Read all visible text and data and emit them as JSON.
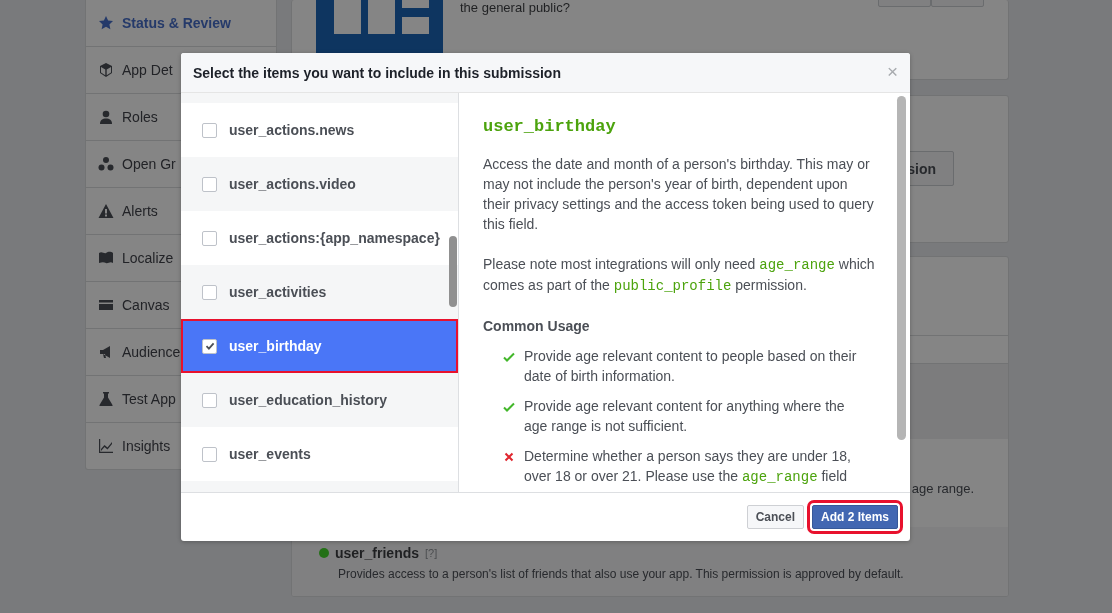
{
  "sidebar": {
    "items": [
      {
        "label": "Status & Review",
        "selected": true
      },
      {
        "label": "App Det",
        "selected": false
      },
      {
        "label": "Roles",
        "selected": false
      },
      {
        "label": "Open Gr",
        "selected": false
      },
      {
        "label": "Alerts",
        "selected": false
      },
      {
        "label": "Localize",
        "selected": false
      },
      {
        "label": "Canvas",
        "selected": false
      },
      {
        "label": "Audience",
        "selected": false
      },
      {
        "label": "Test App",
        "selected": false
      },
      {
        "label": "Insights",
        "selected": false
      }
    ]
  },
  "background": {
    "app_panel": {
      "question": "the general public?"
    },
    "submission_panel": {
      "button": "sion"
    },
    "permissions_panel": {
      "fragment": "age range.",
      "permissions": [
        {
          "name": "user_friends",
          "help": "[?]",
          "description": "Provides access to a person's list of friends that also use your app. This permission is approved by default.",
          "color": "#237016"
        }
      ]
    }
  },
  "dialog": {
    "title": "Select the items you want to include in this submission",
    "close": "×",
    "items": [
      {
        "label": "user_actions.news",
        "checked": false,
        "selected": false
      },
      {
        "label": "user_actions.video",
        "checked": false,
        "selected": false
      },
      {
        "label": "user_actions:{app_namespace}",
        "checked": false,
        "selected": false
      },
      {
        "label": "user_activities",
        "checked": false,
        "selected": false
      },
      {
        "label": "user_birthday",
        "checked": true,
        "selected": true
      },
      {
        "label": "user_education_history",
        "checked": false,
        "selected": false
      },
      {
        "label": "user_events",
        "checked": false,
        "selected": false
      }
    ],
    "detail": {
      "title": "user_birthday",
      "paragraphs": [
        [
          {
            "kind": "plain",
            "text": "Access the date and month of a person's birthday. This may or may not include the person's year of birth, dependent upon their privacy settings and the access token being used to query this field."
          }
        ],
        [
          {
            "kind": "plain",
            "text": "Please note most integrations will only need "
          },
          {
            "kind": "code",
            "text": "age_range"
          },
          {
            "kind": "plain",
            "text": " which comes as part of the "
          },
          {
            "kind": "code",
            "text": "public_profile"
          },
          {
            "kind": "plain",
            "text": " permission."
          }
        ]
      ],
      "usage_title": "Common Usage",
      "usage": [
        {
          "allowed": true,
          "text": [
            {
              "kind": "plain",
              "text": "Provide age relevant content to people based on their date of birth information."
            }
          ]
        },
        {
          "allowed": true,
          "text": [
            {
              "kind": "plain",
              "text": "Provide age relevant content for anything where the age range is not sufficient."
            }
          ]
        },
        {
          "allowed": false,
          "text": [
            {
              "kind": "plain",
              "text": "Determine whether a person says they are under 18, over 18 or over 21. Please use the "
            },
            {
              "kind": "code",
              "text": "age_range"
            },
            {
              "kind": "plain",
              "text": " field"
            }
          ]
        }
      ]
    },
    "buttons": [
      {
        "label": "Cancel",
        "kind": "secondary"
      },
      {
        "label": "Add 2 Items",
        "kind": "primary"
      }
    ]
  }
}
